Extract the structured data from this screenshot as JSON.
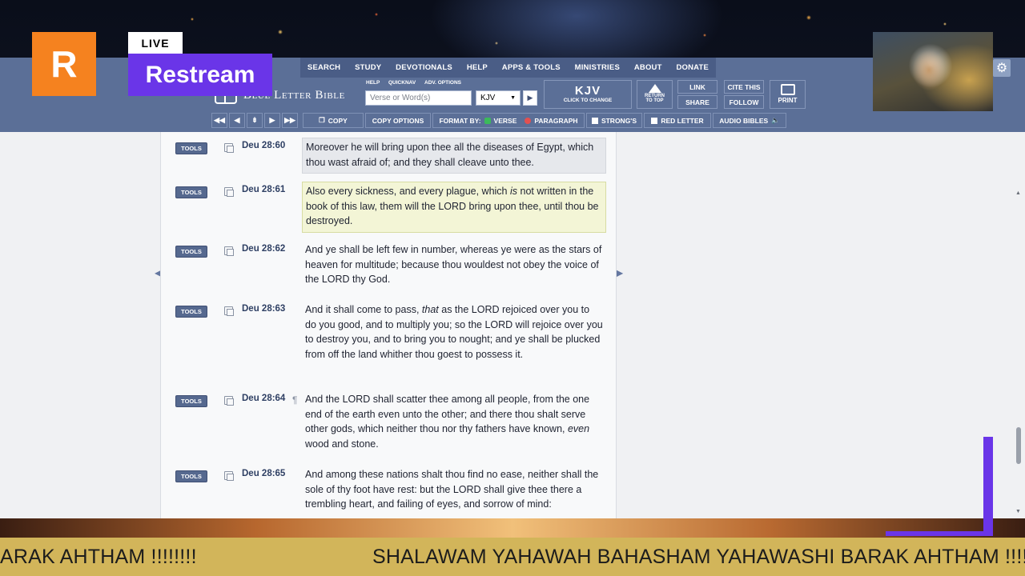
{
  "overlay": {
    "restream_logo_letter": "R",
    "live_label": "LIVE",
    "brand_name": "Restream"
  },
  "menu": [
    "SEARCH",
    "STUDY",
    "DEVOTIONALS",
    "HELP",
    "APPS & TOOLS",
    "MINISTRIES",
    "ABOUT",
    "DONATE"
  ],
  "header": {
    "site_name": "Blue Letter Bible",
    "help_label": "HELP",
    "quicknav_label": "QUICKNAV",
    "adv_options_label": "ADV. OPTIONS",
    "search_placeholder": "Verse or Word(s)",
    "version_value": "KJV",
    "kjv_label": "KJV",
    "kjv_sub": "CLICK TO CHANGE",
    "return_top_1": "RETURN",
    "return_top_2": "TO TOP",
    "link_label": "LINK",
    "share_label": "SHARE",
    "cite_label": "CITE THIS",
    "follow_label": "FOLLOW",
    "print_label": "PRINT"
  },
  "toolbar": {
    "copy_label": "COPY",
    "copy_options_label": "COPY OPTIONS",
    "format_by_label": "FORMAT BY:",
    "verse_label": "VERSE",
    "paragraph_label": "PARAGRAPH",
    "strongs_label": "STRONG'S",
    "red_letter_label": "RED LETTER",
    "audio_label": "AUDIO BIBLES"
  },
  "verses": [
    {
      "ref": "Deu 28:60",
      "tools": "TOOLS",
      "text": "Moreover he will bring upon thee all the diseases of Egypt, which thou wast afraid of; and they shall cleave unto thee."
    },
    {
      "ref": "Deu 28:61",
      "tools": "TOOLS",
      "text_a": "Also every sickness, and every plague, which ",
      "text_em": "is",
      "text_b": " not written in the book of this law, them will the LORD bring upon thee, until thou be destroyed."
    },
    {
      "ref": "Deu 28:62",
      "tools": "TOOLS",
      "text": "And ye shall be left few in number, whereas ye were as the stars of heaven for multitude; because thou wouldest not obey the voice of the LORD thy God."
    },
    {
      "ref": "Deu 28:63",
      "tools": "TOOLS",
      "text_a": "And it shall come to pass, ",
      "text_em": "that",
      "text_b": " as the LORD rejoiced over you to do you good, and to multiply you; so the LORD will rejoice over you to destroy you, and to bring you to nought; and ye shall be plucked from off the land whither thou goest to possess it."
    },
    {
      "ref": "Deu 28:64",
      "tools": "TOOLS",
      "pilcrow": "¶",
      "text_a": "And the LORD shall scatter thee among all people, from the one end of the earth even unto the other; and there thou shalt serve other gods, which neither thou nor thy fathers have known, ",
      "text_em": "even",
      "text_b": " wood and stone."
    },
    {
      "ref": "Deu 28:65",
      "tools": "TOOLS",
      "text": "And among these nations shalt thou find no ease, neither shall the sole of thy foot have rest: but the LORD shall give thee there a trembling heart, and failing of eyes, and sorrow of mind:"
    }
  ],
  "ticker": {
    "left_text": "ARAK AHTHAM !!!!!!!!",
    "right_text": "SHALAWAM YAHAWAH BAHASHAM YAHAWASHI BARAK AHTHAM !!!!!!!!"
  },
  "colors": {
    "header_blue": "#5b6f97",
    "restream_orange": "#f5821f",
    "restream_purple": "#6a35e8",
    "ticker_gold": "#d2b55a"
  },
  "icons": [
    "gear-icon",
    "book-logo-icon",
    "return-top-icon",
    "printer-icon",
    "copy-icon",
    "checkbox-icon",
    "speaker-icon"
  ]
}
